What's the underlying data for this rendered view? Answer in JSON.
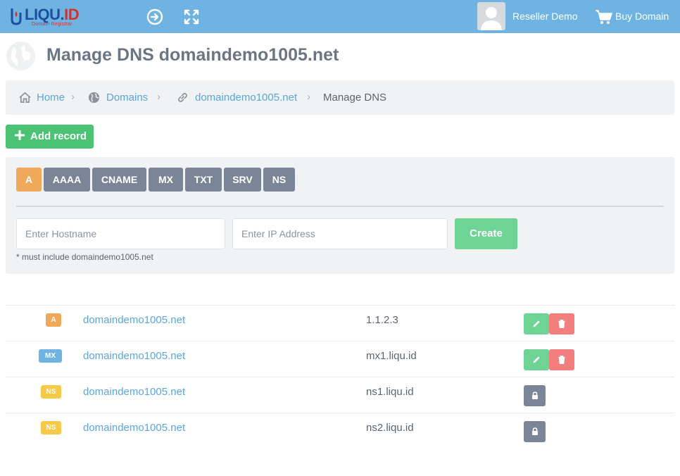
{
  "header": {
    "logo_text": "LIQU.",
    "logo_text_accent": "ID",
    "logo_subtitle": "Domain Registrar",
    "user_name": "Reseller Demo",
    "buy_domain_label": "Buy Domain",
    "icons": [
      "logout-icon",
      "fullscreen-icon",
      "avatar",
      "cart-icon"
    ],
    "colors": {
      "bar": "#6fb3e3"
    }
  },
  "page": {
    "title": "Manage DNS domaindemo1005.net"
  },
  "breadcrumb": {
    "home": "Home",
    "domains": "Domains",
    "domain": "domaindemo1005.net",
    "current": "Manage DNS"
  },
  "add_record_label": "Add record",
  "record_form": {
    "types": [
      "A",
      "AAAA",
      "CNAME",
      "MX",
      "TXT",
      "SRV",
      "NS"
    ],
    "active_type": "A",
    "hostname_placeholder": "Enter Hostname",
    "ip_placeholder": "Enter IP Address",
    "create_label": "Create",
    "hint": "* must include domaindemo1005.net"
  },
  "records": [
    {
      "type": "A",
      "host": "domaindemo1005.net",
      "value": "1.1.2.3",
      "actions": [
        "edit",
        "delete"
      ]
    },
    {
      "type": "MX",
      "host": "domaindemo1005.net",
      "value": "mx1.liqu.id",
      "actions": [
        "edit",
        "delete"
      ]
    },
    {
      "type": "NS",
      "host": "domaindemo1005.net",
      "value": "ns1.liqu.id",
      "actions": [
        "locked"
      ]
    },
    {
      "type": "NS",
      "host": "domaindemo1005.net",
      "value": "ns2.liqu.id",
      "actions": [
        "locked"
      ]
    }
  ],
  "colors": {
    "accent_green": "#4cc374",
    "type_a": "#f0a85a",
    "type_mx": "#6fb3e3",
    "type_ns": "#f7c948",
    "delete_red": "#f27e7e",
    "tab_gray": "#7a8597"
  }
}
